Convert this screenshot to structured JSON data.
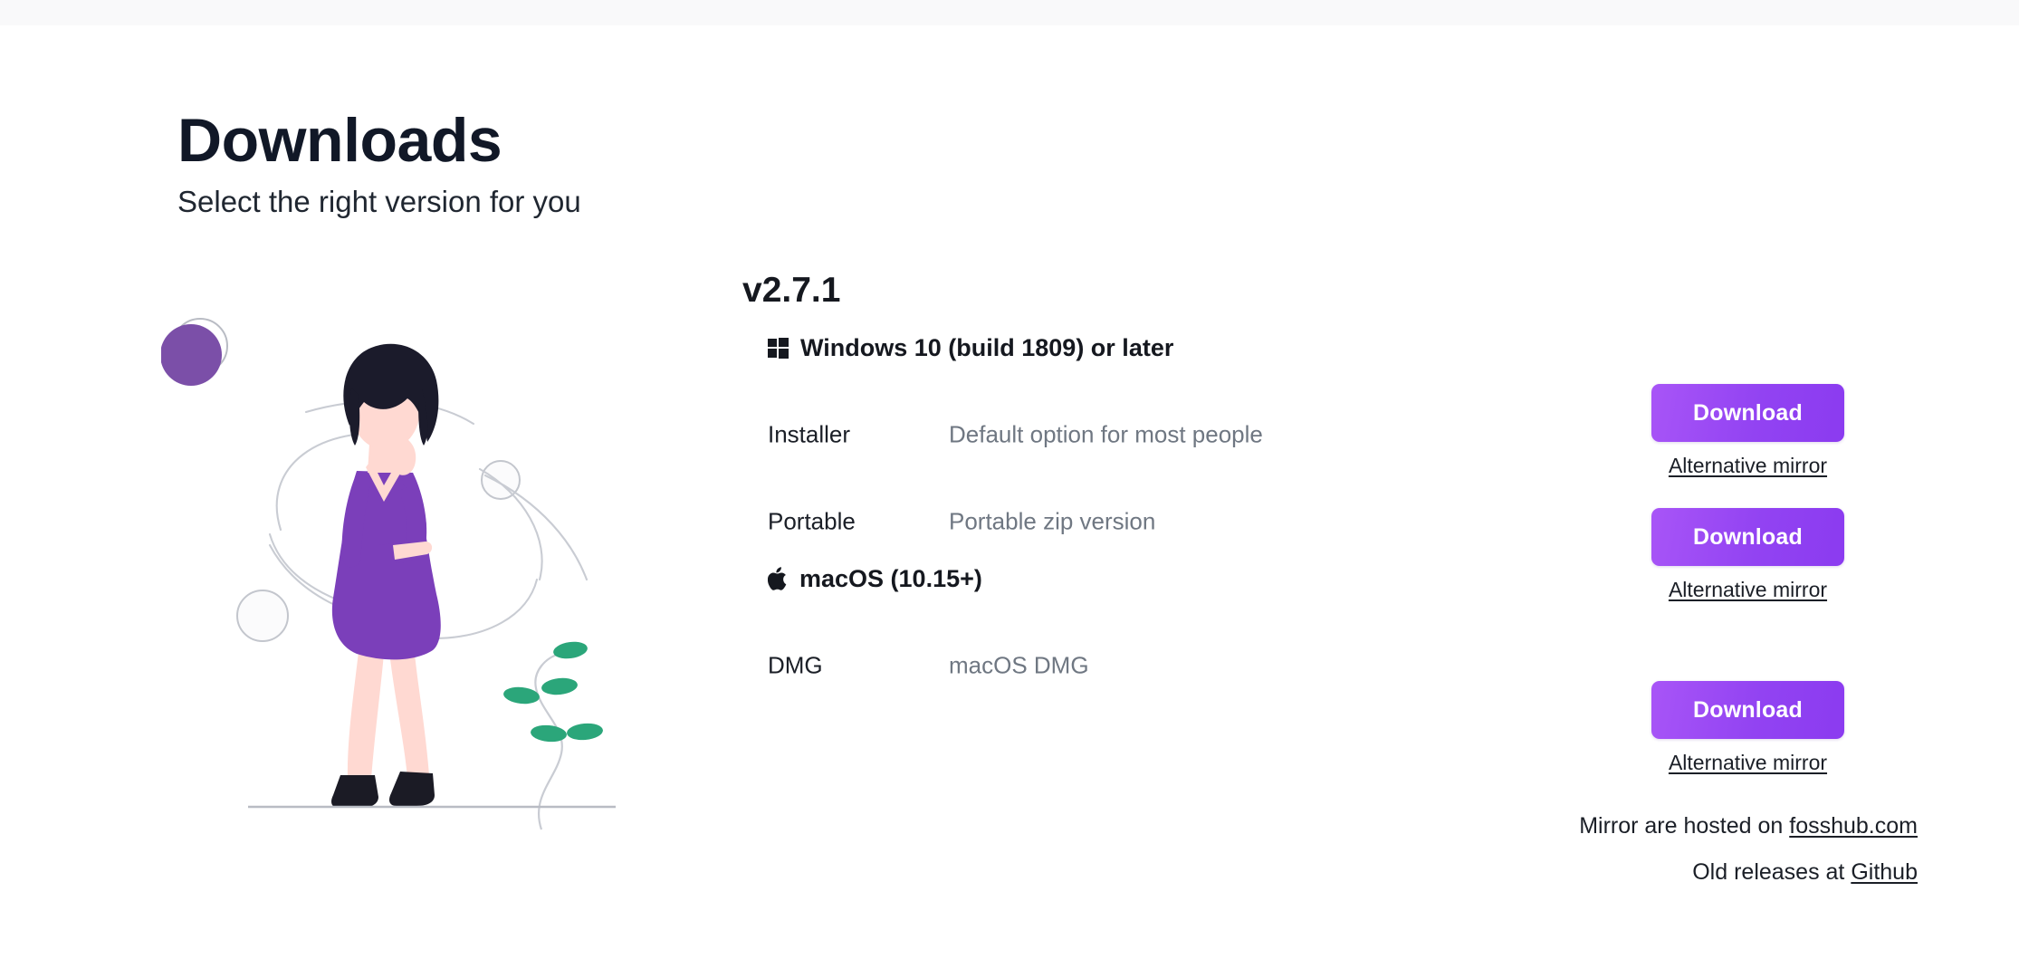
{
  "page": {
    "title": "Downloads",
    "subtitle": "Select the right version for you"
  },
  "release": {
    "version": "v2.7.1"
  },
  "platforms": [
    {
      "icon": "windows-logo-icon",
      "heading": "Windows 10 (build 1809) or later",
      "rows": [
        {
          "name": "Installer",
          "description": "Default option for most people",
          "download_label": "Download",
          "mirror_label": "Alternative mirror"
        },
        {
          "name": "Portable",
          "description": "Portable zip version",
          "download_label": "Download",
          "mirror_label": "Alternative mirror"
        }
      ]
    },
    {
      "icon": "apple-logo-icon",
      "heading": "macOS (10.15+)",
      "rows": [
        {
          "name": "DMG",
          "description": "macOS DMG",
          "download_label": "Download",
          "mirror_label": "Alternative mirror"
        }
      ]
    }
  ],
  "footer": {
    "mirror_note_prefix": "Mirror are hosted on ",
    "mirror_note_link": "fosshub.com",
    "old_releases_prefix": "Old releases at ",
    "old_releases_link": "Github"
  },
  "colors": {
    "accent_purple": "#9243f2",
    "accent_purple_light": "#a855f7",
    "illustration_purple": "#7b4fa8",
    "illustration_green": "#2ba67a",
    "heading_dark": "#15181f",
    "muted_text": "#6f7782"
  },
  "illustration": {
    "name": "woman-standing-illustration",
    "elements": [
      "purple-filled-circle",
      "outlined-circle-small",
      "outlined-circle-medium",
      "swirl-lines",
      "woman-figure",
      "plant-sprig",
      "ground-line"
    ]
  }
}
